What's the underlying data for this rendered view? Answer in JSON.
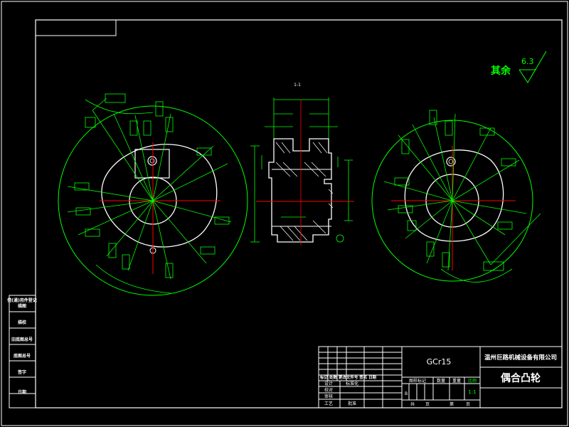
{
  "material": "GCr15",
  "company": "温州巨路机械设备有限公司",
  "part_name": "偶合凸轮",
  "surface_note": {
    "label": "其余",
    "roughness": "6.3"
  },
  "section_label": "1-1",
  "scale_label": "比例",
  "scale_value": "1:1",
  "stage_mark": "B",
  "title_block_headers": [
    "图样标记",
    "数量",
    "重量"
  ],
  "sheet_labels": {
    "total": "共",
    "page": "页",
    "sheet_no": "第",
    "page2": "页"
  },
  "revision_header": "标记 处数 更改文件号 签名 日期",
  "signoff_rows": [
    {
      "role": "设计",
      "extra": "标准化"
    },
    {
      "role": "校对",
      "extra": ""
    },
    {
      "role": "审核",
      "extra": ""
    },
    {
      "role": "工艺",
      "extra": "批准"
    }
  ],
  "side_table": [
    "借(通)用件登记",
    "描图",
    "描校",
    "旧底图总号",
    "底图总号",
    "签字",
    "日期"
  ],
  "colors": {
    "frame": "#ffffff",
    "dimension": "#00ff00",
    "centerline": "#ff0000",
    "outline": "#ffffff"
  }
}
